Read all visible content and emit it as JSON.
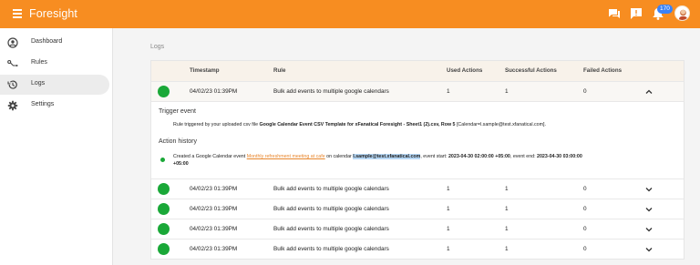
{
  "app": {
    "title": "Foresight",
    "notification_count": "170"
  },
  "colors": {
    "accent": "#f78d21",
    "success": "#1aa838",
    "badge": "#3b82f6"
  },
  "sidebar": {
    "items": [
      {
        "label": "Dashboard",
        "icon": "dashboard-icon",
        "active": false
      },
      {
        "label": "Rules",
        "icon": "rules-icon",
        "active": false
      },
      {
        "label": "Logs",
        "icon": "history-icon",
        "active": true
      },
      {
        "label": "Settings",
        "icon": "gear-icon",
        "active": false
      }
    ]
  },
  "page": {
    "breadcrumb": "Logs"
  },
  "table": {
    "headers": [
      "Timestamp",
      "Rule",
      "Used Actions",
      "Successful Actions",
      "Failed Actions"
    ],
    "rows": [
      {
        "timestamp": "04/02/23 01:39PM",
        "rule": "Bulk add events to multiple google calendars",
        "used": "1",
        "successful": "1",
        "failed": "0",
        "expanded": true
      },
      {
        "timestamp": "04/02/23 01:39PM",
        "rule": "Bulk add events to multiple google calendars",
        "used": "1",
        "successful": "1",
        "failed": "0",
        "expanded": false
      },
      {
        "timestamp": "04/02/23 01:39PM",
        "rule": "Bulk add events to multiple google calendars",
        "used": "1",
        "successful": "1",
        "failed": "0",
        "expanded": false
      },
      {
        "timestamp": "04/02/23 01:39PM",
        "rule": "Bulk add events to multiple google calendars",
        "used": "1",
        "successful": "1",
        "failed": "0",
        "expanded": false
      },
      {
        "timestamp": "04/02/23 01:39PM",
        "rule": "Bulk add events to multiple google calendars",
        "used": "1",
        "successful": "1",
        "failed": "0",
        "expanded": false
      }
    ]
  },
  "detail": {
    "trigger_title": "Trigger event",
    "trigger_prefix": "Rule triggered by your uploaded csv file ",
    "trigger_file": "Google Calendar Event CSV Template for xFanatical Foresight - Sheet1 (2).csv, Row 5",
    "trigger_suffix": " [Calendar=l.sample@test.xfanatical.com].",
    "history_title": "Action history",
    "history_prefix": "Created a Google Calendar event ",
    "history_link": "Monthly refreshment meeting at cafe",
    "history_mid": " on calendar ",
    "history_calendar": "l.sample@test.xfanatical.com",
    "history_start_label": ", event start: ",
    "history_start": "2023-04-30 02:00:00 +05:00",
    "history_end_label": ", event end: ",
    "history_end": "2023-04-30 03:00:00",
    "history_end_tz": "+05:00"
  }
}
